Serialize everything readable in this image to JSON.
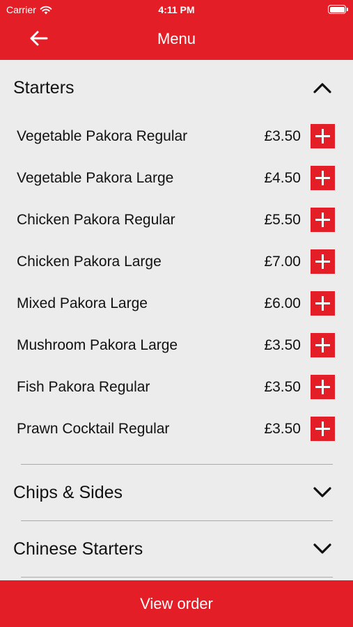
{
  "status_bar": {
    "carrier": "Carrier",
    "time": "4:11 PM"
  },
  "header": {
    "title": "Menu",
    "back_icon": "arrow-left-icon"
  },
  "categories": [
    {
      "name": "Starters",
      "expanded": true,
      "items": [
        {
          "name": "Vegetable Pakora Regular",
          "price": "£3.50"
        },
        {
          "name": "Vegetable Pakora Large",
          "price": "£4.50"
        },
        {
          "name": "Chicken Pakora Regular",
          "price": "£5.50"
        },
        {
          "name": "Chicken Pakora Large",
          "price": "£7.00"
        },
        {
          "name": "Mixed Pakora Large",
          "price": "£6.00"
        },
        {
          "name": "Mushroom Pakora Large",
          "price": "£3.50"
        },
        {
          "name": "Fish Pakora Regular",
          "price": "£3.50"
        },
        {
          "name": "Prawn Cocktail Regular",
          "price": "£3.50"
        }
      ]
    },
    {
      "name": "Chips & Sides",
      "expanded": false
    },
    {
      "name": "Chinese Starters",
      "expanded": false
    }
  ],
  "footer": {
    "view_order_label": "View order"
  },
  "colors": {
    "accent": "#e41e26",
    "background": "#ececec"
  }
}
